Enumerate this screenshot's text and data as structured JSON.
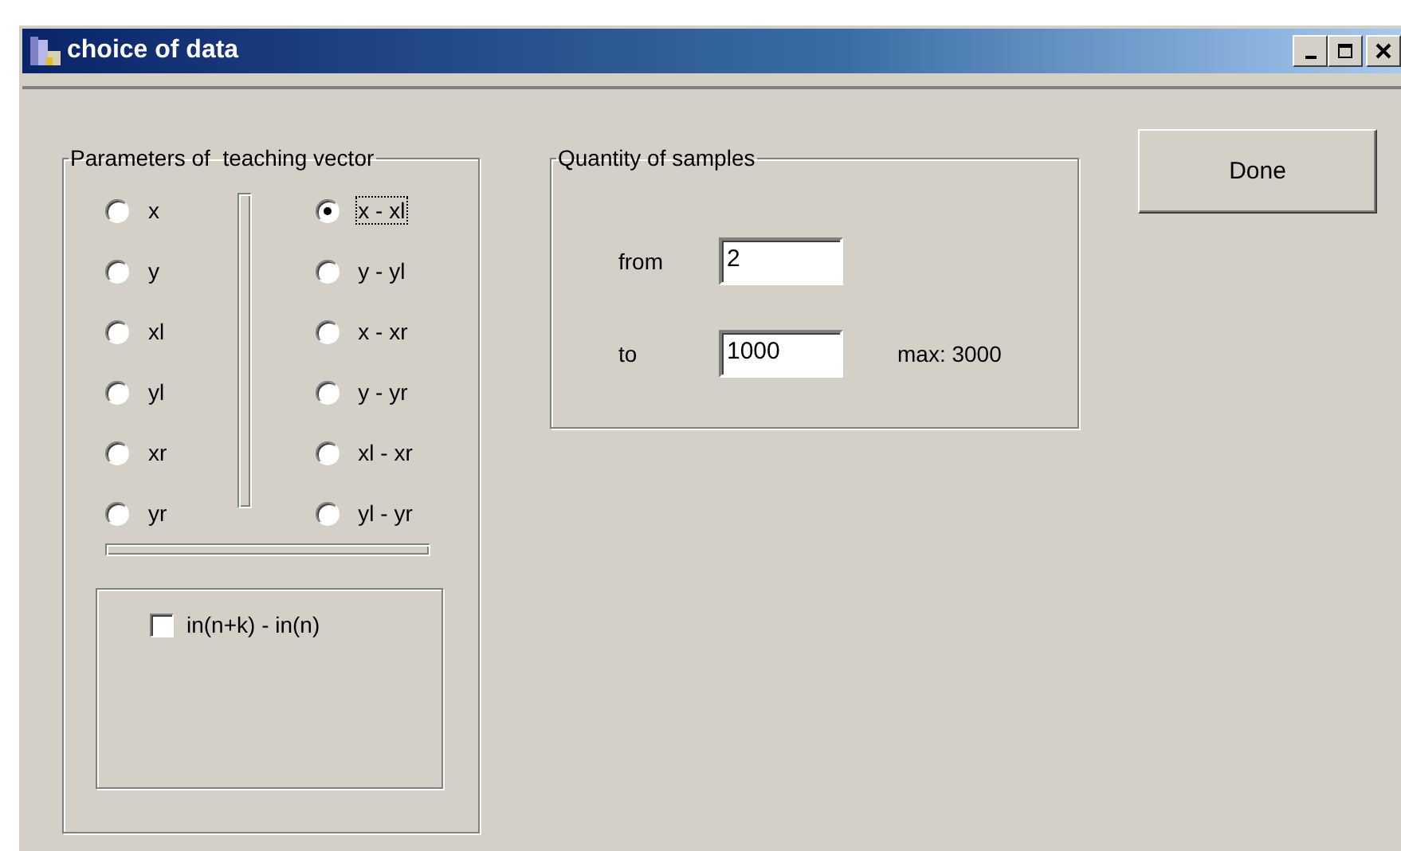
{
  "window": {
    "title": "choice of data"
  },
  "teaching_vector": {
    "title": "Parameters of  teaching vector",
    "left_options": [
      {
        "label": "x",
        "selected": false,
        "focused": false
      },
      {
        "label": "y",
        "selected": false,
        "focused": false
      },
      {
        "label": "xl",
        "selected": false,
        "focused": false
      },
      {
        "label": "yl",
        "selected": false,
        "focused": false
      },
      {
        "label": "xr",
        "selected": false,
        "focused": false
      },
      {
        "label": "yr",
        "selected": false,
        "focused": false
      }
    ],
    "right_options": [
      {
        "label": "x - xl",
        "selected": true,
        "focused": true
      },
      {
        "label": "y - yl",
        "selected": false,
        "focused": false
      },
      {
        "label": "x - xr",
        "selected": false,
        "focused": false
      },
      {
        "label": "y - yr",
        "selected": false,
        "focused": false
      },
      {
        "label": "xl - xr",
        "selected": false,
        "focused": false
      },
      {
        "label": "yl - yr",
        "selected": false,
        "focused": false
      }
    ],
    "checkbox": {
      "label": "in(n+k) - in(n)",
      "checked": false
    }
  },
  "samples": {
    "title": "Quantity of samples",
    "fields": [
      {
        "label": "from",
        "value": "2"
      },
      {
        "label": "to",
        "value": "1000",
        "note": "max: 3000"
      }
    ]
  },
  "buttons": [
    {
      "label": "Done"
    }
  ]
}
